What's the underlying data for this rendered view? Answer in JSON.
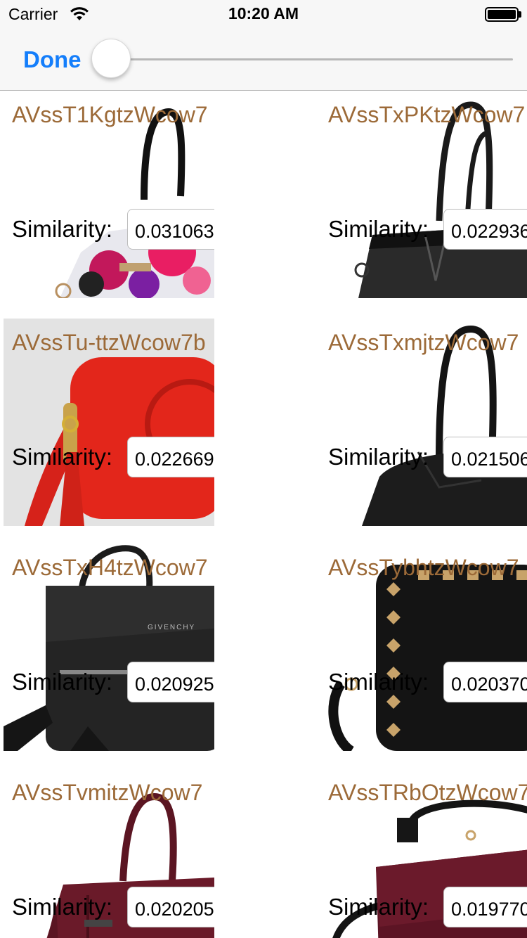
{
  "status_bar": {
    "carrier": "Carrier",
    "time": "10:20 AM"
  },
  "toolbar": {
    "done_label": "Done",
    "slider_value": 0.0
  },
  "colors": {
    "title": "#9c6a38",
    "accent": "#147efb"
  },
  "results": [
    {
      "title": "AVssT1KgtzWcow7",
      "similarity_label": "Similarity:",
      "similarity_value": "0.031063",
      "image_icon": "floral-handbag-image"
    },
    {
      "title": "AVssTxPKtzWcow7",
      "similarity_label": "Similarity:",
      "similarity_value": "0.022936",
      "image_icon": "black-croc-tote-image"
    },
    {
      "title": "AVssTu-ttzWcow7b",
      "similarity_label": "Similarity:",
      "similarity_value": "0.022669",
      "image_icon": "red-crossbody-image"
    },
    {
      "title": "AVssTxmjtzWcow7",
      "similarity_label": "Similarity:",
      "similarity_value": "0.021506",
      "image_icon": "black-leather-bag-image"
    },
    {
      "title": "AVssTxH4tzWcow7",
      "similarity_label": "Similarity:",
      "similarity_value": "0.020925",
      "image_icon": "givenchy-pandora-image"
    },
    {
      "title": "AVssTybhtzWcow7",
      "similarity_label": "Similarity:",
      "similarity_value": "0.020370",
      "image_icon": "studded-camera-bag-image"
    },
    {
      "title": "AVssTvmitzWcow7",
      "similarity_label": "Similarity:",
      "similarity_value": "0.020205",
      "image_icon": "burgundy-tote-image"
    },
    {
      "title": "AVssTRbOtzWcow7",
      "similarity_label": "Similarity:",
      "similarity_value": "0.019770",
      "image_icon": "burgundy-flap-bag-image"
    }
  ]
}
